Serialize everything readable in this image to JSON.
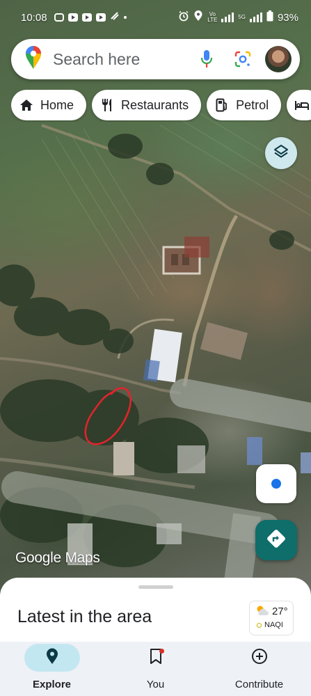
{
  "status_bar": {
    "time": "10:08",
    "network_top": "Vo",
    "network_bottom": "LTE",
    "network_type": "5G",
    "battery": "93%"
  },
  "search": {
    "placeholder": "Search here",
    "mic_icon": "mic-icon",
    "lens_icon": "google-lens-icon"
  },
  "chips": [
    {
      "label": "Home",
      "icon": "home-icon"
    },
    {
      "label": "Restaurants",
      "icon": "restaurant-icon"
    },
    {
      "label": "Petrol",
      "icon": "fuel-pump-icon"
    },
    {
      "label": "",
      "icon": "hotel-bed-icon"
    }
  ],
  "map": {
    "watermark": "Google Maps"
  },
  "sheet": {
    "title": "Latest in the area",
    "weather": {
      "temperature": "27°",
      "aqi_label": "NAQI"
    }
  },
  "nav": {
    "explore": "Explore",
    "you": "You",
    "contribute": "Contribute"
  },
  "colors": {
    "accent_teal": "#0f6d6a",
    "active_tab_pill": "#c3e7f0",
    "location_blue": "#1a73e8",
    "annotation_red": "#e0242c"
  }
}
